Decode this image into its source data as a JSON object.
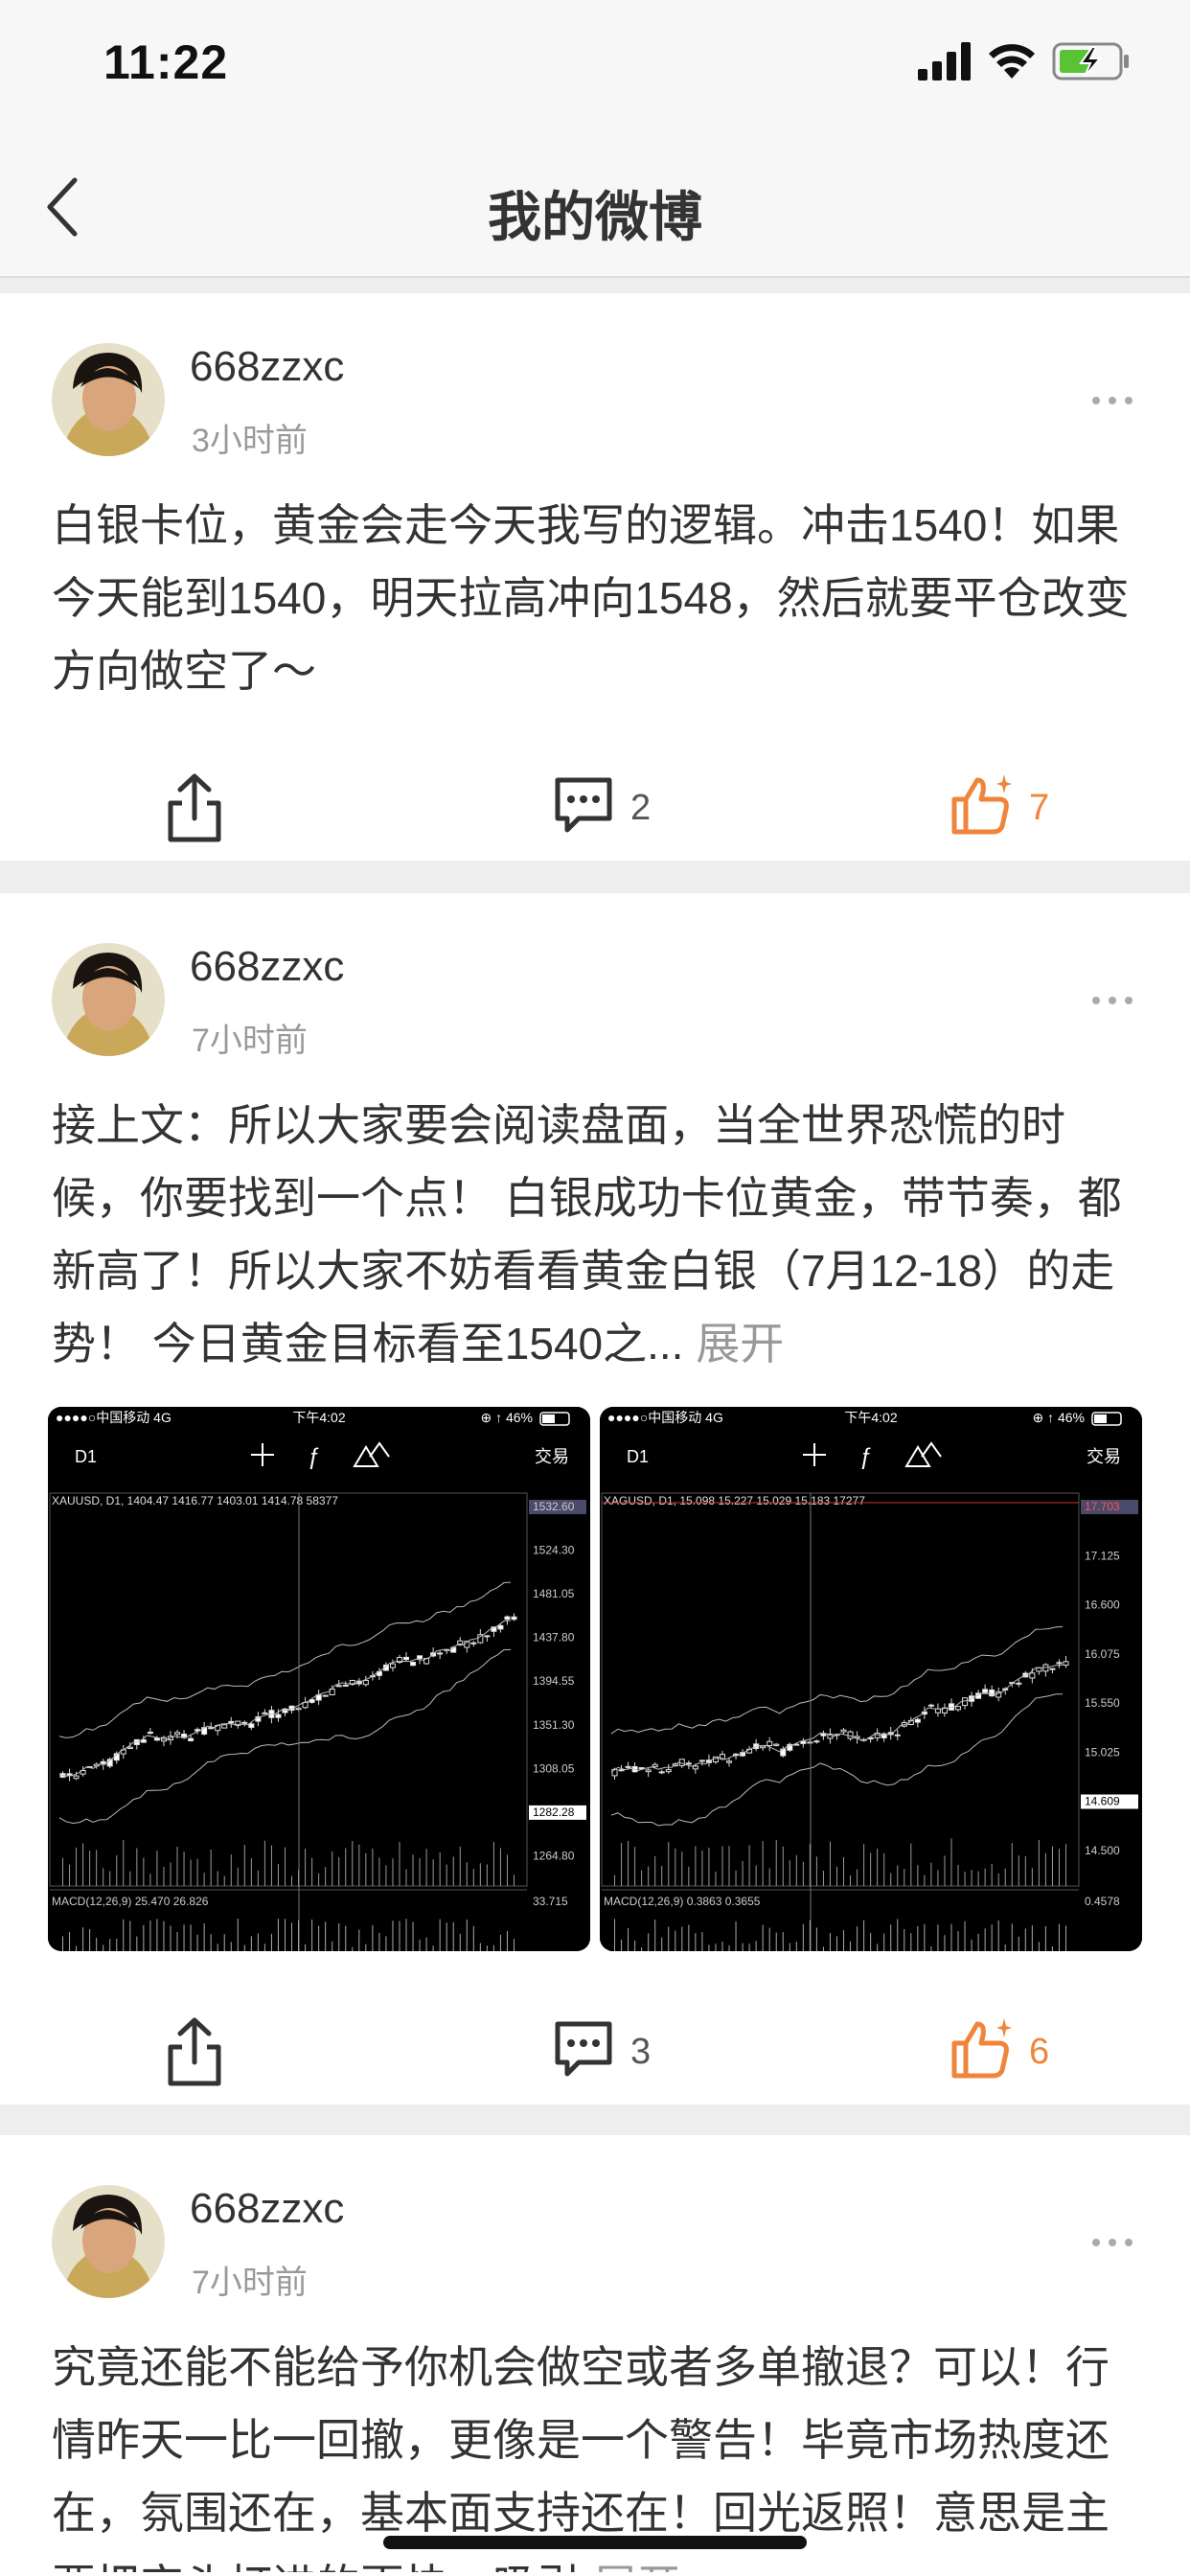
{
  "status_bar": {
    "time": "11:22"
  },
  "nav": {
    "title": "我的微博"
  },
  "posts": [
    {
      "username": "668zzxc",
      "time": "3小时前",
      "text": "白银卡位，黄金会走今天我写的逻辑。冲击1540！如果今天能到1540，明天拉高冲向1548，然后就要平仓改变方向做空了～",
      "comments": "2",
      "likes": "7"
    },
    {
      "username": "668zzxc",
      "time": "7小时前",
      "text": "接上文：所以大家要会阅读盘面，当全世界恐慌的时候，你要找到一个点！ 白银成功卡位黄金，带节奏，都新高了！所以大家不妨看看黄金白银（7月12-18）的走势！ 今日黄金目标看至1540之...",
      "expand": "展开",
      "comments": "3",
      "likes": "6",
      "images": [
        {
          "carrier": "●●●●○中国移动  4G",
          "clock": "下午4:02",
          "battery_pct": "⊕ ↑ 46%",
          "timeframe": "D1",
          "trade": "交易",
          "symbol_line": "XAUUSD, D1, 1404.47 1416.77 1403.01 1414.78 58377",
          "price_labels": [
            "1532.60",
            "1524.30",
            "1481.05",
            "1437.80",
            "1394.55",
            "1351.30",
            "1308.05",
            "1282.28",
            "1264.80"
          ],
          "macd_label": "MACD(12,26,9) 25.470 26.826",
          "macd_value": "33.715"
        },
        {
          "carrier": "●●●●○中国移动  4G",
          "clock": "下午4:02",
          "battery_pct": "⊕ ↑ 46%",
          "timeframe": "D1",
          "trade": "交易",
          "symbol_line": "XAGUSD, D1, 15.098 15.227 15.029 15.183 17277",
          "price_labels": [
            "17.703",
            "17.125",
            "16.600",
            "16.075",
            "15.550",
            "15.025",
            "14.609",
            "14.500"
          ],
          "macd_label": "MACD(12,26,9) 0.3863 0.3655",
          "macd_value": "0.4578"
        }
      ]
    },
    {
      "username": "668zzxc",
      "time": "7小时前",
      "text": "究竟还能不能给予你机会做空或者多单撤退？可以！行情昨天一比一回撤，更像是一个警告！毕竟市场热度还在，氛围还在，基本面支持还在！回光返照！意思是主要把空头打进的更快一吸引",
      "expand": "展开"
    }
  ],
  "colors": {
    "like": "#f0843a",
    "muted": "#999999",
    "text": "#333333"
  }
}
